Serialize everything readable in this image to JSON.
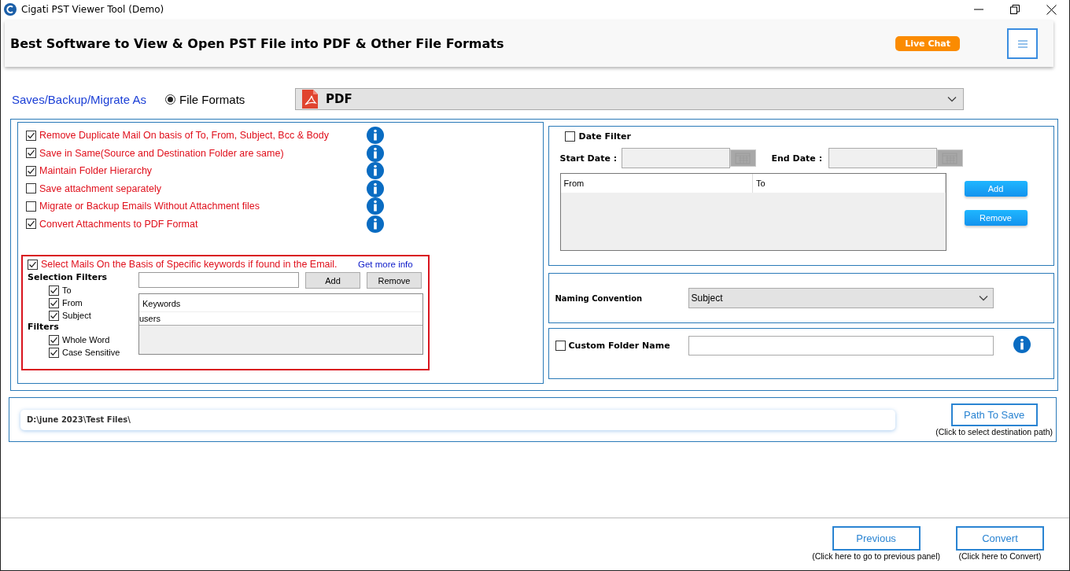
{
  "window": {
    "title": "Cigati PST Viewer Tool (Demo)"
  },
  "header": {
    "title": "Best Software to View & Open PST File into PDF & Other File Formats",
    "live_chat": "Live Chat"
  },
  "save_as": {
    "label": "Saves/Backup/Migrate As",
    "radio": {
      "label": "File Formats",
      "selected": true
    },
    "format": "PDF"
  },
  "options": [
    {
      "label": "Remove Duplicate Mail On basis of To, From, Subject, Bcc & Body",
      "checked": true
    },
    {
      "label": "Save in Same(Source and Destination Folder are same)",
      "checked": true
    },
    {
      "label": "Maintain Folder Hierarchy",
      "checked": true
    },
    {
      "label": "Save attachment separately",
      "checked": false
    },
    {
      "label": "Migrate or Backup Emails Without Attachment files",
      "checked": false
    },
    {
      "label": "Convert Attachments to PDF Format",
      "checked": true
    }
  ],
  "keyword_filter": {
    "label": "Select Mails On the Basis of Specific keywords if found in the Email.",
    "checked": true,
    "link": "Get more info",
    "selection_filters_title": "Selection Filters",
    "selection_filters": [
      {
        "label": "To",
        "checked": true
      },
      {
        "label": "From",
        "checked": true
      },
      {
        "label": "Subject",
        "checked": true
      }
    ],
    "filters_title": "Filters",
    "filters": [
      {
        "label": "Whole Word",
        "checked": true
      },
      {
        "label": "Case Sensitive",
        "checked": true
      }
    ],
    "add": "Add",
    "remove": "Remove",
    "keywords_column": "Keywords",
    "keywords": [
      "users"
    ]
  },
  "date_filter": {
    "label": "Date Filter",
    "checked": false,
    "start_label": "Start Date :",
    "end_label": "End Date :",
    "columns": [
      "From",
      "To"
    ],
    "add": "Add",
    "remove": "Remove"
  },
  "naming_convention": {
    "label": "Naming Convention",
    "value": "Subject"
  },
  "custom_folder": {
    "label": "Custom Folder Name",
    "checked": false
  },
  "path": {
    "value": "D:\\june 2023\\Test Files\\",
    "button": "Path To Save",
    "hint": "(Click to select destination path)"
  },
  "footer": [
    {
      "label": "Previous",
      "hint": "(Click here to go to previous panel)"
    },
    {
      "label": "Convert",
      "hint": "(Click here to Convert)"
    }
  ]
}
